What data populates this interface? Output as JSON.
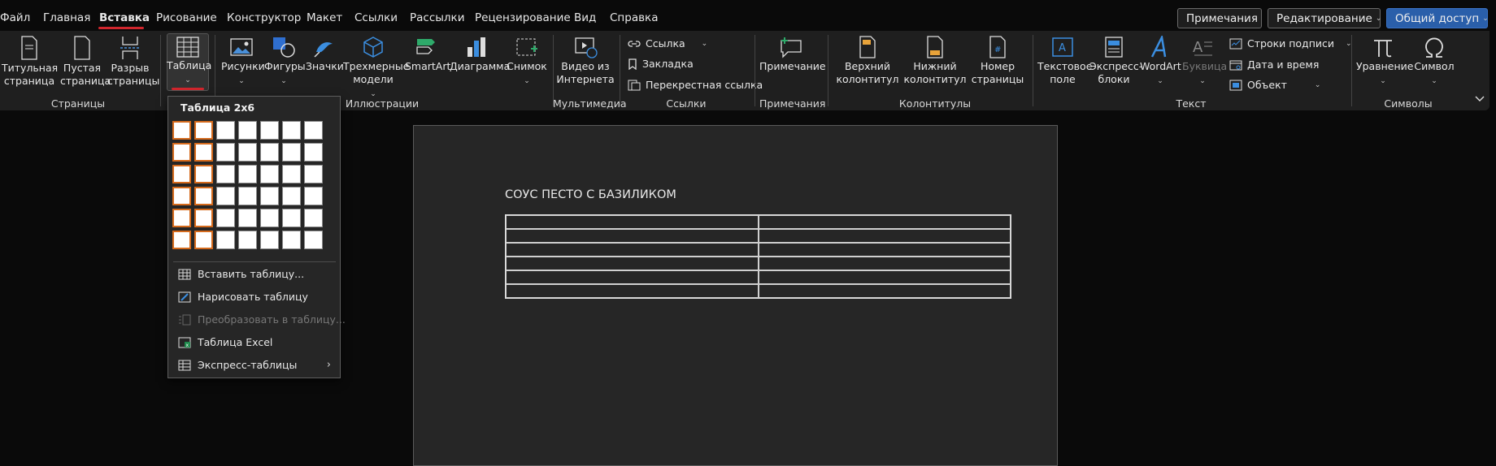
{
  "tabs": [
    "Файл",
    "Главная",
    "Вставка",
    "Рисование",
    "Конструктор",
    "Макет",
    "Ссылки",
    "Рассылки",
    "Рецензирование",
    "Вид",
    "Справка"
  ],
  "header_buttons": {
    "comments": "Примечания",
    "editing": "Редактирование",
    "share": "Общий доступ"
  },
  "ribbon": {
    "pages": {
      "cover": "Титульная страница",
      "blank": "Пустая страница",
      "break": "Разрыв страницы",
      "label": "Страницы"
    },
    "table": {
      "label": "Таблица"
    },
    "illustrations": {
      "pictures": "Рисунки",
      "shapes": "Фигуры",
      "icons": "Значки",
      "models3d": "Трехмерные модели",
      "smartart": "SmartArt",
      "chart": "Диаграмма",
      "screenshot": "Снимок",
      "label": "Иллюстрации"
    },
    "media": {
      "video": "Видео из Интернета",
      "label": "Мультимедиа"
    },
    "links": {
      "link": "Ссылка",
      "bookmark": "Закладка",
      "crossref": "Перекрестная ссылка",
      "label": "Ссылки"
    },
    "comments": {
      "comment": "Примечание",
      "label": "Примечания"
    },
    "headerfooter": {
      "header": "Верхний колонтитул",
      "footer": "Нижний колонтитул",
      "pagenum": "Номер страницы",
      "label": "Колонтитулы"
    },
    "text": {
      "textbox": "Текстовое поле",
      "quickparts": "Экспресс-блоки",
      "wordart": "WordArt",
      "dropcap": "Буквица",
      "signature": "Строки подписи",
      "datetime": "Дата и время",
      "object": "Объект",
      "label": "Текст"
    },
    "symbols": {
      "equation": "Уравнение",
      "symbol": "Символ",
      "label": "Символы"
    }
  },
  "dropdown": {
    "title": "Таблица 2x6",
    "selected_cols": 2,
    "selected_rows": 6,
    "items": [
      {
        "label": "Вставить таблицу...",
        "enabled": true
      },
      {
        "label": "Нарисовать таблицу",
        "enabled": true
      },
      {
        "label": "Преобразовать в таблицу...",
        "enabled": false
      },
      {
        "label": "Таблица Excel",
        "enabled": true
      },
      {
        "label": "Экспресс-таблицы",
        "enabled": true
      }
    ]
  },
  "document": {
    "title": "СОУС ПЕСТО С БАЗИЛИКОМ",
    "table_rows": 6,
    "table_cols": 2
  },
  "colors": {
    "accent": "#d0262d",
    "share": "#2a5faa",
    "grid_highlight": "#d56a1c"
  }
}
